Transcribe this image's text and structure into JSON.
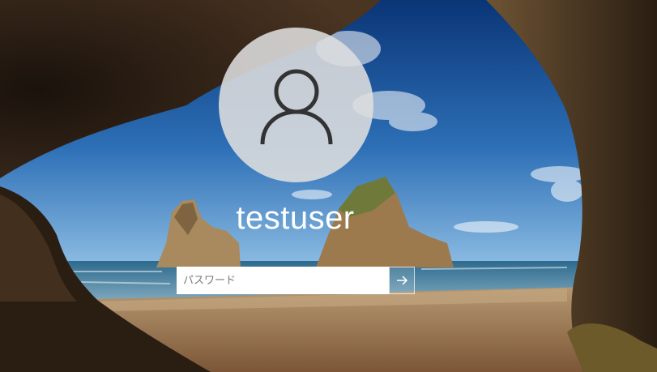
{
  "user": {
    "name": "testuser"
  },
  "password_field": {
    "placeholder": "パスワード",
    "value": ""
  },
  "submit": {
    "icon": "arrow-right-icon"
  },
  "avatar": {
    "icon": "person-icon"
  },
  "colors": {
    "sky_top": "#0b3f86",
    "sky_bottom": "#6aa2d2",
    "sea": "#2c5f7c",
    "sand": "#9b7650",
    "rock": "#3a2a1c"
  }
}
